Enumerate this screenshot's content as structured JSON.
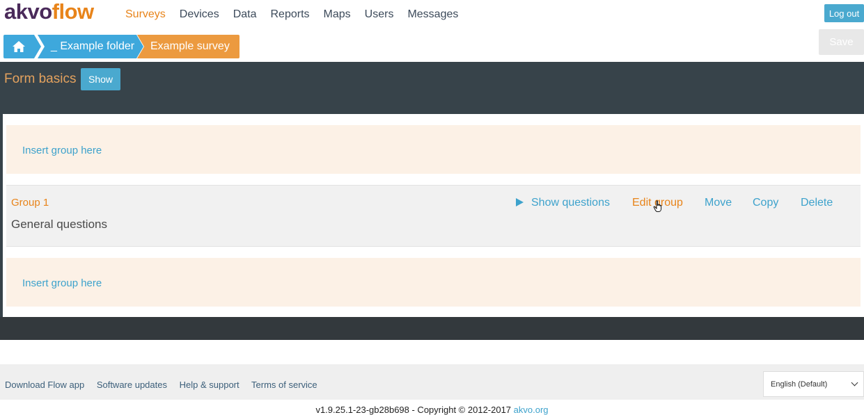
{
  "header": {
    "logo_part1": "akvo",
    "logo_part2": "flow",
    "nav": [
      "Surveys",
      "Devices",
      "Data",
      "Reports",
      "Maps",
      "Users",
      "Messages"
    ],
    "logout_label": "Log out"
  },
  "breadcrumb": {
    "home_icon": "home-icon",
    "folder": "_ Example folder",
    "survey": "Example survey"
  },
  "toolbar": {
    "save_label": "Save"
  },
  "form": {
    "title": "Form basics",
    "show_label": "Show"
  },
  "groups_panel": {
    "insert_label_top": "Insert group here",
    "insert_label_bottom": "Insert group here",
    "group": {
      "title": "Group 1",
      "description": "General questions",
      "actions": {
        "show_questions": "Show questions",
        "edit_group": "Edit group",
        "move": "Move",
        "copy": "Copy",
        "delete": "Delete"
      }
    }
  },
  "footer": {
    "links": [
      "Download Flow app",
      "Software updates",
      "Help & support",
      "Terms of service"
    ],
    "language": "English (Default)",
    "copyright_text": "v1.9.25.1-23-gb28b698 - Copyright © 2012-2017",
    "copyright_link": "akvo.org"
  },
  "colors": {
    "brand_orange": "#e8841a",
    "brand_blue": "#3ea8dc",
    "dark_band": "#37434a",
    "insert_bg": "#fcf1e6"
  }
}
